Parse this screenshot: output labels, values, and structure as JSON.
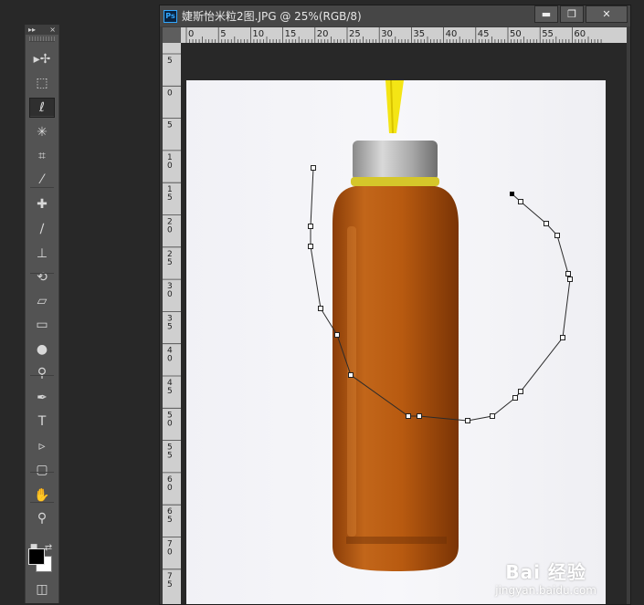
{
  "tools_panel": {
    "header_left": "▸▸",
    "header_right": "×",
    "tools": [
      {
        "name": "move-tool",
        "icon": "move-icon",
        "glyph": "▸✢"
      },
      {
        "name": "rectangular-marquee-tool",
        "icon": "marquee-icon",
        "glyph": "⬚"
      },
      {
        "name": "lasso-tool",
        "icon": "polygonal-lasso-icon",
        "glyph": "ℓ",
        "active": true
      },
      {
        "name": "magic-wand-tool",
        "icon": "magic-wand-icon",
        "glyph": "✳"
      },
      {
        "name": "crop-tool",
        "icon": "crop-icon",
        "glyph": "⌗"
      },
      {
        "name": "eyedropper-tool",
        "icon": "eyedropper-icon",
        "glyph": "⁄"
      },
      {
        "name": "healing-brush-tool",
        "icon": "healing-brush-icon",
        "glyph": "✚"
      },
      {
        "name": "brush-tool",
        "icon": "brush-icon",
        "glyph": "∕"
      },
      {
        "name": "clone-stamp-tool",
        "icon": "stamp-icon",
        "glyph": "⊥"
      },
      {
        "name": "history-brush-tool",
        "icon": "history-brush-icon",
        "glyph": "⟲"
      },
      {
        "name": "eraser-tool",
        "icon": "eraser-icon",
        "glyph": "▱"
      },
      {
        "name": "gradient-tool",
        "icon": "gradient-icon",
        "glyph": "▭"
      },
      {
        "name": "blur-tool",
        "icon": "blur-drop-icon",
        "glyph": "●"
      },
      {
        "name": "dodge-tool",
        "icon": "dodge-icon",
        "glyph": "⚲"
      },
      {
        "name": "pen-tool",
        "icon": "pen-icon",
        "glyph": "✒"
      },
      {
        "name": "type-tool",
        "icon": "type-icon",
        "glyph": "T"
      },
      {
        "name": "path-selection-tool",
        "icon": "path-select-arrow-icon",
        "glyph": "▹"
      },
      {
        "name": "shape-tool",
        "icon": "rounded-rectangle-icon",
        "glyph": "▢"
      },
      {
        "name": "hand-tool",
        "icon": "hand-icon",
        "glyph": "✋"
      },
      {
        "name": "zoom-tool",
        "icon": "zoom-icon",
        "glyph": "⚲"
      }
    ],
    "foreground_color": "#000000",
    "background_color": "#ffffff"
  },
  "document": {
    "title": "婕斯怡米粒2图.JPG @ 25%(RGB/8)",
    "app_badge": "Ps",
    "minimize_label": "▬",
    "restore_label": "❐",
    "close_label": "✕",
    "ruler_top_ticks": [
      "0",
      "5",
      "10",
      "15",
      "20",
      "25",
      "30",
      "35",
      "40",
      "45",
      "50",
      "55",
      "60"
    ],
    "ruler_left_ticks": [
      "5",
      "0",
      "5",
      "1\n0",
      "1\n5",
      "2\n0",
      "2\n5",
      "3\n0",
      "3\n5",
      "4\n0",
      "4\n5",
      "5\n0",
      "5\n5",
      "6\n0",
      "6\n5",
      "7\n0",
      "7\n5"
    ]
  },
  "watermark": {
    "brand": "Bai 经验",
    "site": "jingyan.baidu.com"
  },
  "colors": {
    "app_bg": "#282828",
    "panel_bg": "#535353",
    "liquid": "#b45a12",
    "cap": "#a8a8a8",
    "strap": "#f2e313"
  }
}
